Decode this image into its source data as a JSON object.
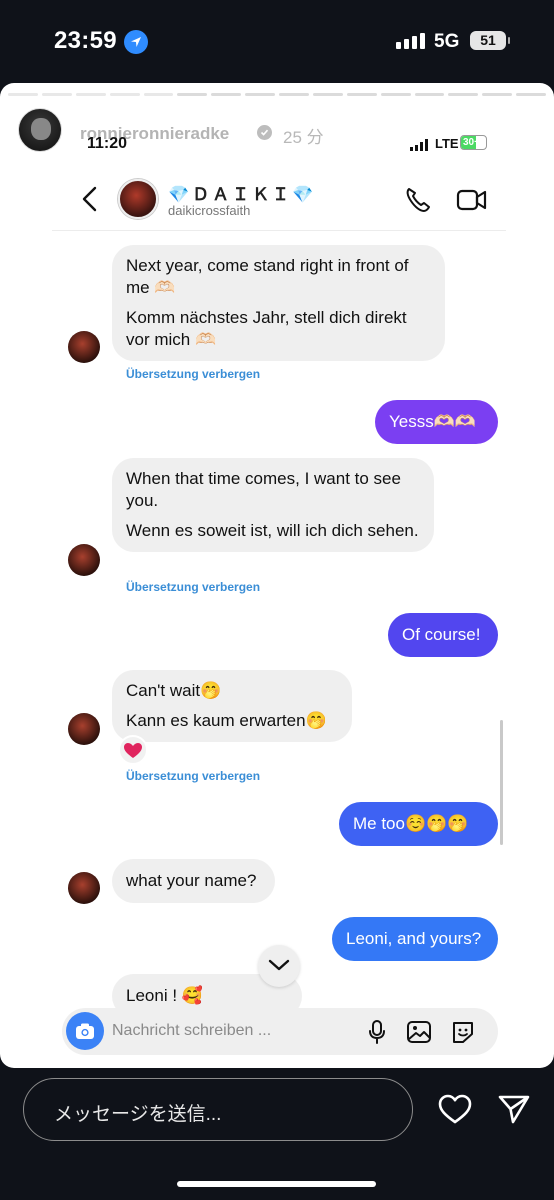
{
  "status_bar": {
    "time": "23:59",
    "network": "5G",
    "battery": "51"
  },
  "story": {
    "username": "ronnieronnieradke",
    "posted_ago": "25 分",
    "progress_segments": 16,
    "active_segment": 5
  },
  "screenshot": {
    "status": {
      "time": "11:20",
      "network": "LTE",
      "battery": "30+"
    },
    "header": {
      "name": "💎ＤＡＩＫＩ💎",
      "handle": "daikicrossfaith"
    },
    "hide_translation": "Übersetzung verbergen",
    "messages": [
      {
        "direction": "in",
        "text": "Next year, come stand right in front of me 🫶🏻",
        "translation": "Komm nächstes Jahr, stell dich direkt vor mich 🫶🏻"
      },
      {
        "direction": "out",
        "text": "Yesss🫶🏻🫶🏻"
      },
      {
        "direction": "in",
        "text": "When that time comes, I want to see you.",
        "translation": "Wenn es soweit ist, will ich dich sehen."
      },
      {
        "direction": "out",
        "text": "Of course!"
      },
      {
        "direction": "in",
        "text": "Can't wait🤭",
        "translation": "Kann es kaum erwarten🤭",
        "reaction": "❤️"
      },
      {
        "direction": "out",
        "text": "Me too☺️🤭🤭"
      },
      {
        "direction": "in",
        "text": "what your name?"
      },
      {
        "direction": "out",
        "text": "Leoni, and yours?"
      },
      {
        "direction": "in",
        "text": "Leoni ! 🥰"
      }
    ],
    "composer": {
      "placeholder": "Nachricht schreiben ..."
    }
  },
  "reply": {
    "placeholder": "メッセージを送信..."
  },
  "colors": {
    "outgoing_top": "#7b3ff2",
    "outgoing_mid": "#4f4ff0",
    "outgoing_bottom": "#3478f6",
    "incoming": "#efefef",
    "link": "#3b8ed6"
  }
}
